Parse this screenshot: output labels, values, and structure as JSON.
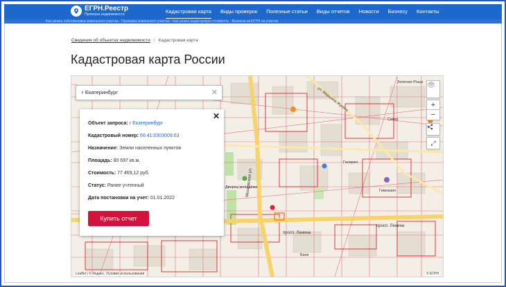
{
  "site": {
    "logo_title": "ЕГРН.Реестр",
    "logo_subtitle": "Проверка недвижимости"
  },
  "nav": {
    "items": [
      {
        "label": "Кадастровая карта",
        "active": true
      },
      {
        "label": "Виды проверок"
      },
      {
        "label": "Полезные статьи"
      },
      {
        "label": "Виды отчетов"
      },
      {
        "label": "Новости"
      },
      {
        "label": "Бизнесу"
      },
      {
        "label": "Контакты"
      }
    ]
  },
  "strip_text": "Как узнать собственника земельного участка  ·  Проверка земельного участка  ·  Как узнать кадастровую стоимость  ·  Выписка из ЕГРН на участок",
  "breadcrumb": {
    "parent": "Сведения об объектах недвижимости",
    "current": "Кадастровая карта"
  },
  "page_title": "Кадастровая карта России",
  "map": {
    "search_value": "г Екатеринбург",
    "labels": [
      "Московская ул.",
      "просп. Ленина",
      "просп. Ленина",
      "ул. Маршала Жукова",
      "Дворец молодёжи",
      "Галерея",
      "Гимназия",
      "Сквер",
      "Банк",
      "Зеленая Роща"
    ],
    "attribution": "Leaflet | © Яндекс, Условия использования",
    "attribution_right": "© ЕГРН"
  },
  "info_card": {
    "rows": [
      {
        "label": "Объект запроса:",
        "value": "г Екатеринбург",
        "link": true
      },
      {
        "label": "Кадастровый номер:",
        "value": "66:41:0303009:63",
        "link": true
      },
      {
        "label": "Назначение:",
        "value": "Земли населенных пунктов"
      },
      {
        "label": "Площадь:",
        "value": "80 697 кв.м."
      },
      {
        "label": "Стоимость:",
        "value": "77 469,12 руб."
      },
      {
        "label": "Статус:",
        "value": "Ранее учтенный"
      },
      {
        "label": "Дата постановки на учет:",
        "value": "01.01.2022"
      }
    ],
    "button_label": "Купить отчет"
  },
  "colors": {
    "brand": "#1d68cc",
    "button": "#d5133a",
    "parcel_lines": "#d9232d"
  }
}
